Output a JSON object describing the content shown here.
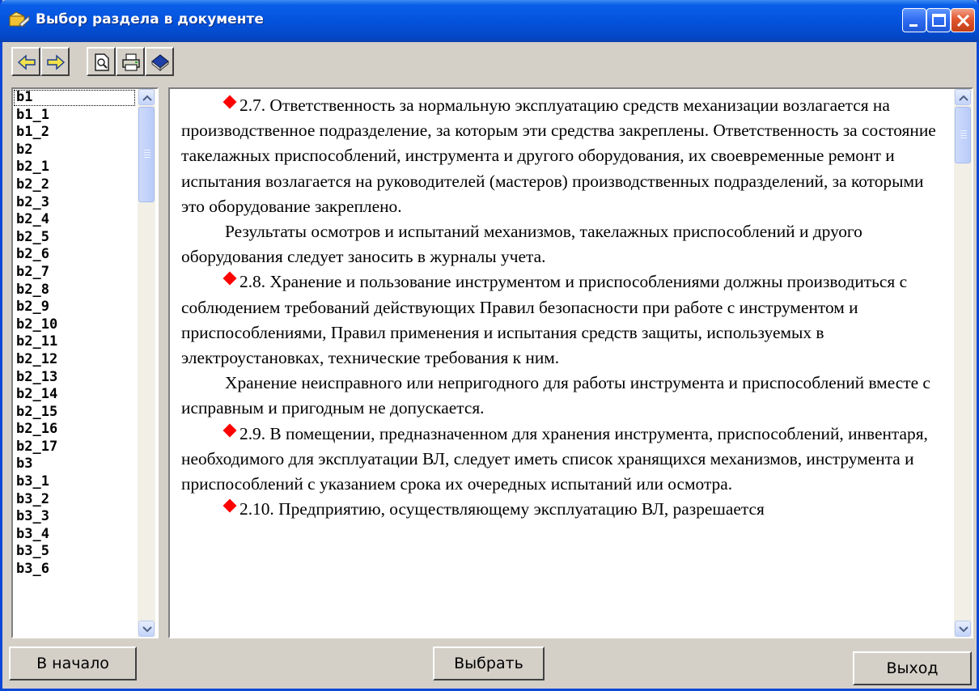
{
  "window": {
    "title": "Выбор раздела в документе"
  },
  "toolbar": {
    "buttons": [
      "back-arrow-icon",
      "forward-arrow-icon",
      "print-preview-icon",
      "print-icon",
      "book-icon"
    ]
  },
  "section_list": {
    "items": [
      "b1",
      "b1_1",
      "b1_2",
      "b2",
      "b2_1",
      "b2_2",
      "b2_3",
      "b2_4",
      "b2_5",
      "b2_6",
      "b2_7",
      "b2_8",
      "b2_9",
      "b2_10",
      "b2_11",
      "b2_12",
      "b2_13",
      "b2_14",
      "b2_15",
      "b2_16",
      "b2_17",
      "b3",
      "b3_1",
      "b3_2",
      "b3_3",
      "b3_4",
      "b3_5",
      "b3_6"
    ],
    "selected": "b1"
  },
  "document": {
    "paragraphs": [
      {
        "marker": true,
        "text": "2.7. Ответственность за нормальную эксплуатацию средств механизации возлагается на производственное подразделение, за которым эти средства закреплены. Ответственность за состояние такелажных приспособлений, инструмента и другого оборудования, их своевременные ремонт и испытания возлагается на руководителей (мастеров) производственных подразделений, за которыми это оборудование закреплено."
      },
      {
        "marker": false,
        "text": "Результаты осмотров и испытаний механизмов, такелажных приспособлений и друого оборудования следует заносить в журналы учета."
      },
      {
        "marker": true,
        "text": "2.8. Хранение и пользование инструментом и приспособлениями должны производиться с соблюдением требований действующих Правил безопасности при работе с инструментом и приспособлениями, Правил применения и испытания средств защиты, используемых в электроустановках, технические требования к ним."
      },
      {
        "marker": false,
        "text": "Хранение неисправного или непригодного для работы инструмента и приспособлений вместе с исправным и пригодным не допускается."
      },
      {
        "marker": true,
        "text": "2.9. В помещении, предназначенном для хранения инструмента, приспособлений, инвентаря, необходимого для эксплуатации ВЛ, следует иметь список хранящихся механизмов, инструмента и приспособлений с указанием срока их очередных испытаний или осмотра."
      },
      {
        "marker": true,
        "text": "2.10. Предприятию, осуществляющему эксплуатацию ВЛ, разрешается"
      }
    ]
  },
  "buttons": {
    "home_label": "В начало",
    "select_label": "Выбрать",
    "exit_label": "Выход"
  }
}
